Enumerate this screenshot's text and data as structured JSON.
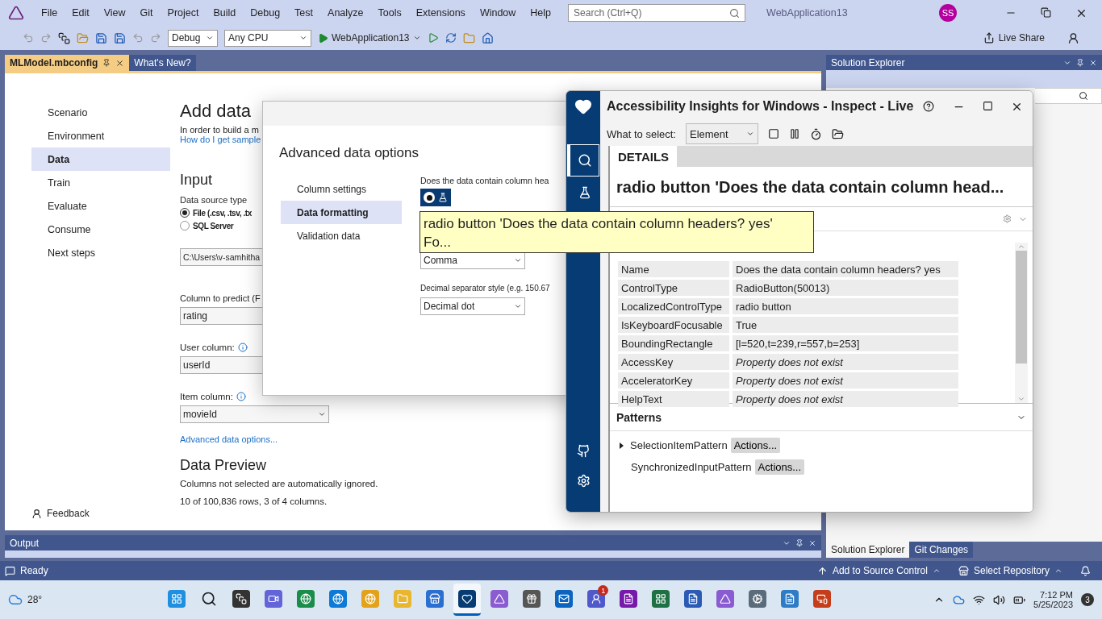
{
  "menu": [
    "File",
    "Edit",
    "View",
    "Git",
    "Project",
    "Build",
    "Debug",
    "Test",
    "Analyze",
    "Tools",
    "Extensions",
    "Window",
    "Help"
  ],
  "search": {
    "placeholder": "Search (Ctrl+Q)"
  },
  "window": {
    "title": "WebApplication13",
    "avatar": "SS"
  },
  "toolbar": {
    "configuration": "Debug",
    "platform": "Any CPU",
    "run_target": "WebApplication13",
    "live_share": "Live Share"
  },
  "doc_tabs": [
    {
      "label": "MLModel.mbconfig",
      "selected": true
    },
    {
      "label": "What's New?",
      "selected": false
    }
  ],
  "steps": [
    {
      "label": "Scenario",
      "selected": false
    },
    {
      "label": "Environment",
      "selected": false
    },
    {
      "label": "Data",
      "selected": true
    },
    {
      "label": "Train",
      "selected": false
    },
    {
      "label": "Evaluate",
      "selected": false
    },
    {
      "label": "Consume",
      "selected": false
    },
    {
      "label": "Next steps",
      "selected": false
    }
  ],
  "feedback": "Feedback",
  "page": {
    "title": "Add data",
    "intro": "In order to build a m",
    "help_link": "How do I get sample",
    "input_heading": "Input",
    "source_label": "Data source type",
    "sources": [
      {
        "label": "File (.csv, .tsv, .tx",
        "selected": true
      },
      {
        "label": "SQL Server",
        "selected": false
      }
    ],
    "path": "C:\\Users\\v-samhitha",
    "predict_label": "Column to predict (F",
    "predict_value": "rating",
    "user_label": "User column:",
    "user_value": "userId",
    "item_label": "Item column:",
    "item_value": "movieId",
    "advanced_link": "Advanced data options...",
    "preview_heading": "Data Preview",
    "preview_note": "Columns not selected are automatically ignored.",
    "preview_count": "10 of 100,836 rows, 3 of 4 columns."
  },
  "dialog": {
    "title": "Advanced data options",
    "nav": [
      {
        "label": "Column settings",
        "selected": false
      },
      {
        "label": "Data formatting",
        "selected": true
      },
      {
        "label": "Validation data",
        "selected": false
      }
    ],
    "question": "Does the data contain column hea",
    "radio_selected": true,
    "separator_value": "Comma",
    "decimal_label": "Decimal separator style (e.g. 150.67",
    "decimal_value": "Decimal dot"
  },
  "tooltip": {
    "line1": "radio button 'Does the data contain column headers? yes'",
    "line2": "Fo..."
  },
  "inspector": {
    "title": "Accessibility Insights for Windows - Inspect - Live",
    "select_label": "What to select:",
    "select_value": "Element",
    "tab": "DETAILS",
    "heading": "radio button 'Does the data contain column head...",
    "properties": [
      {
        "name": "Name",
        "value": "Does the data contain column headers? yes",
        "missing": false
      },
      {
        "name": "ControlType",
        "value": "RadioButton(50013)",
        "missing": false
      },
      {
        "name": "LocalizedControlType",
        "value": "radio button",
        "missing": false
      },
      {
        "name": "IsKeyboardFocusable",
        "value": "True",
        "missing": false
      },
      {
        "name": "BoundingRectangle",
        "value": "[l=520,t=239,r=557,b=253]",
        "missing": false
      },
      {
        "name": "AccessKey",
        "value": "Property does not exist",
        "missing": true
      },
      {
        "name": "AcceleratorKey",
        "value": "Property does not exist",
        "missing": true
      },
      {
        "name": "HelpText",
        "value": "Property does not exist",
        "missing": true
      }
    ],
    "patterns_heading": "Patterns",
    "patterns": [
      {
        "name": "SelectionItemPattern",
        "expandable": true,
        "action": "Actions..."
      },
      {
        "name": "SynchronizedInputPattern",
        "expandable": false,
        "action": "Actions..."
      }
    ]
  },
  "solution_explorer": {
    "title": "Solution Explorer",
    "tabs": [
      {
        "label": "Solution Explorer",
        "selected": true
      },
      {
        "label": "Git Changes",
        "selected": false
      }
    ]
  },
  "output": {
    "title": "Output"
  },
  "status_bar": {
    "state": "Ready",
    "source_control": "Add to Source Control",
    "repository": "Select Repository"
  },
  "taskbar": {
    "weather": "28°",
    "apps": [
      {
        "kind": "start",
        "active": false
      },
      {
        "kind": "search",
        "active": false
      },
      {
        "kind": "taskview",
        "active": false
      },
      {
        "kind": "chat",
        "active": false
      },
      {
        "kind": "edge-dev",
        "active": false
      },
      {
        "kind": "edge",
        "active": false
      },
      {
        "kind": "chrome",
        "active": false
      },
      {
        "kind": "files",
        "active": false
      },
      {
        "kind": "store",
        "active": false
      },
      {
        "kind": "insights",
        "active": true
      },
      {
        "kind": "vs-preview",
        "active": false
      },
      {
        "kind": "gift",
        "active": false
      },
      {
        "kind": "outlook",
        "active": false
      },
      {
        "kind": "teams",
        "active": false,
        "badge": "1"
      },
      {
        "kind": "onenote",
        "active": false
      },
      {
        "kind": "excel",
        "active": false
      },
      {
        "kind": "word",
        "active": false
      },
      {
        "kind": "vs",
        "active": false
      },
      {
        "kind": "settings",
        "active": false
      },
      {
        "kind": "notepad",
        "active": false
      },
      {
        "kind": "powerpoint",
        "active": false
      }
    ],
    "time": "7:12 PM",
    "date": "5/25/2023",
    "notifications": "3"
  }
}
